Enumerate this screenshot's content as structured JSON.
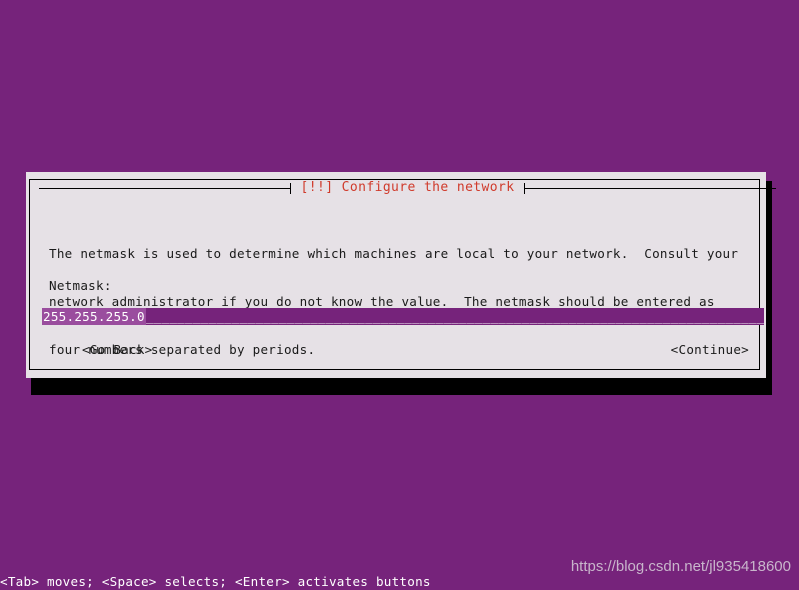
{
  "screen": {
    "background_color": "#76237b",
    "foreground_color": "#ffffff"
  },
  "dialog": {
    "title": "[!!] Configure the network",
    "title_color": "#d03a2b",
    "background_color": "#e6e1e6",
    "description_lines": [
      "The netmask is used to determine which machines are local to your network.  Consult your",
      "network administrator if you do not know the value.  The netmask should be entered as",
      "four numbers separated by periods."
    ],
    "field": {
      "label": "Netmask:",
      "value": "255.255.255.0",
      "placeholder": "",
      "fill": "______________________________________________________________________________________",
      "selection_color": "#9a4d9e",
      "field_color": "#76237b"
    },
    "buttons": {
      "go_back": "<Go Back>",
      "continue": "<Continue>"
    }
  },
  "status_bar": {
    "hint": "<Tab> moves; <Space> selects; <Enter> activates buttons"
  },
  "watermark": {
    "text": "https://blog.csdn.net/jl935418600"
  }
}
